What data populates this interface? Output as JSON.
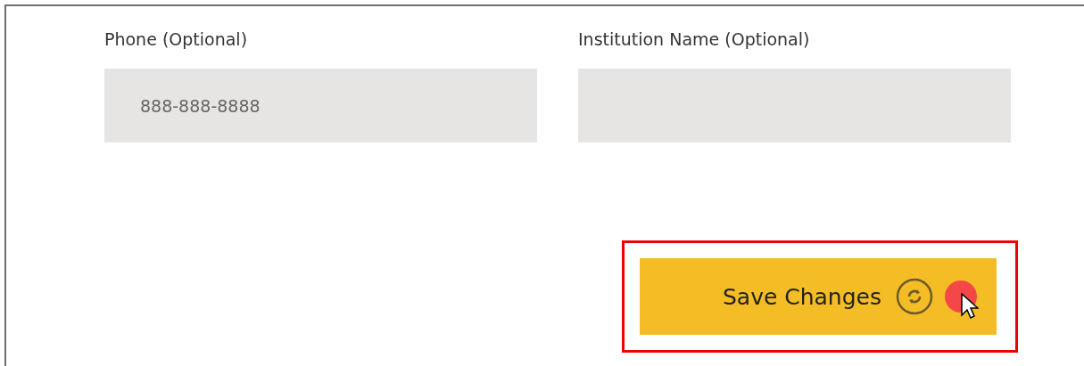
{
  "fields": [
    {
      "label": "Phone (Optional)",
      "placeholder": "888-888-8888"
    },
    {
      "label": "Institution Name (Optional)"
    }
  ],
  "save_button": {
    "label": "Save Changes",
    "highlighted": true,
    "clicked": true
  }
}
